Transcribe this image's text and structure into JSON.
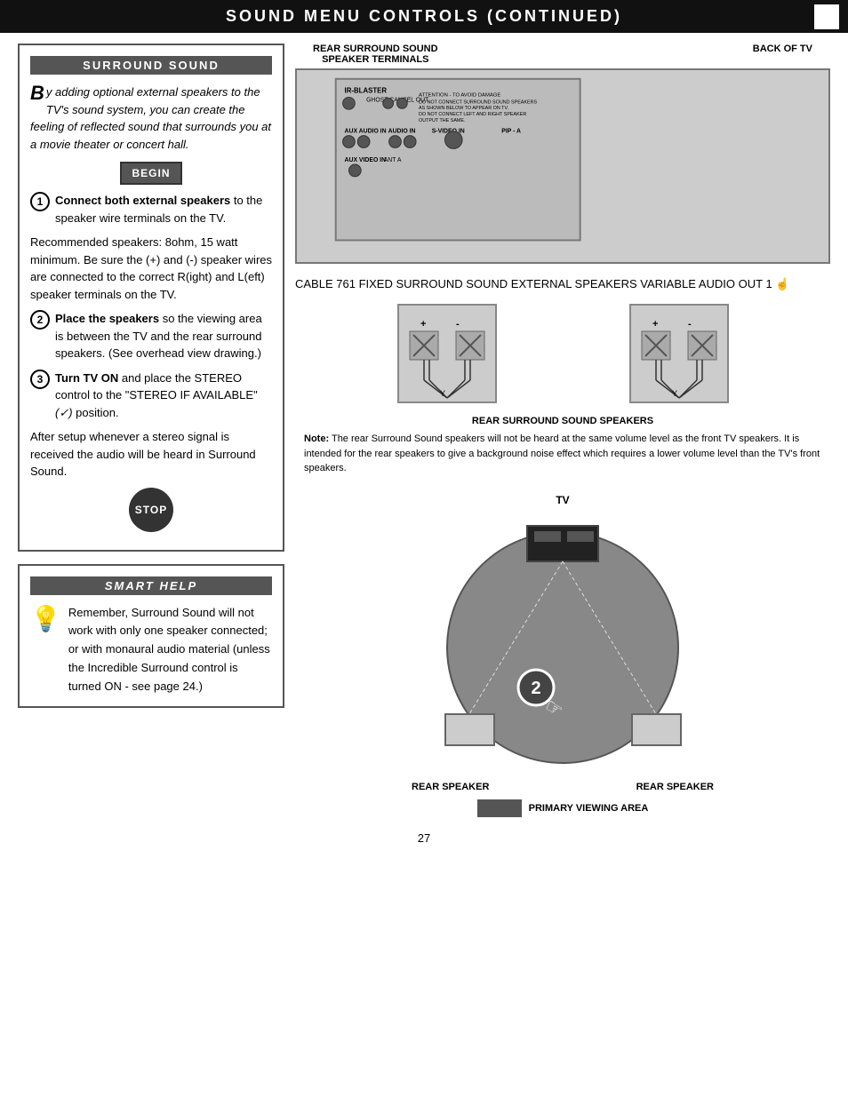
{
  "header": {
    "title": "Sound Menu Controls (Continued)",
    "box_decoration": true
  },
  "surround_section": {
    "title": "Surround Sound",
    "intro": {
      "drop_cap": "B",
      "text": "y adding optional external speakers to the TV's sound system, you can create the feeling of reflected sound that surrounds you at a movie theater or concert hall."
    },
    "begin_label": "BEGIN",
    "steps": [
      {
        "number": "1",
        "bold_text": "Connect both external speakers",
        "text": " to the speaker wire terminals on the TV."
      },
      {
        "number": "",
        "bold_text": "",
        "text": "Recommended speakers: 8ohm, 15 watt minimum. Be sure the (+) and (-) speaker wires are connected to the correct R(ight) and L(eft) speaker terminals on the TV."
      },
      {
        "number": "2",
        "bold_text": "Place the speakers",
        "text": " so the viewing area is between the TV and the rear surround speakers. (See overhead view drawing.)"
      },
      {
        "number": "3",
        "bold_text": "Turn TV ON",
        "text": " and place the STEREO control to the \"STEREO IF AVAILABLE\" (✓) position."
      },
      {
        "number": "",
        "bold_text": "",
        "text": "After setup whenever a stereo signal is received the audio will be heard in Surround Sound."
      }
    ],
    "stop_label": "STOP"
  },
  "smart_help": {
    "title": "Smart Help",
    "text": "Remember, Surround Sound will not work with only one speaker connected; or with monaural audio material (unless the Incredible Surround control is turned ON - see page 24.)"
  },
  "diagram": {
    "rear_surround_label": "REAR SURROUND SOUND\nSPEAKER TERMINALS",
    "back_of_tv_label": "BACK OF TV",
    "number_badge": "1",
    "rear_speakers_label": "REAR SURROUND SOUND SPEAKERS",
    "note": "Note: The rear Surround Sound speakers will not be heard at the same volume level as the front TV speakers. It is intended for the rear speakers to give a background noise effect which requires a lower volume level than the TV's front speakers.",
    "tv_overhead_label": "TV",
    "step2_label": "2",
    "rear_speaker_left_label": "REAR SPEAKER",
    "rear_speaker_right_label": "REAR SPEAKER",
    "primary_viewing_label": "PRIMARY VIEWING AREA"
  },
  "page_number": "27"
}
